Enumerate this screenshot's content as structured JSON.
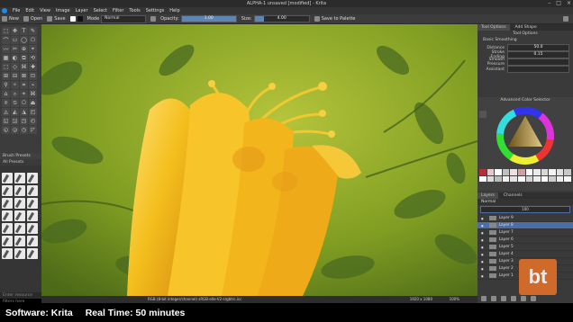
{
  "window": {
    "title": "ALPHA-1 unsaved [modified] - Krita"
  },
  "menu": [
    "File",
    "Edit",
    "View",
    "Image",
    "Layer",
    "Select",
    "Filter",
    "Tools",
    "Settings",
    "Help"
  ],
  "toolbar": {
    "new": "New",
    "open": "Open",
    "save": "Save",
    "blend_label": "Mode",
    "blend_value": "Normal",
    "opacity_label": "Opacity:",
    "opacity_value": "1.00",
    "opacity": 1.0,
    "size_label": "Size:",
    "size_value": "4.00",
    "palette_button": "Save to Palette"
  },
  "brush_presets": {
    "title": "Brush Presets",
    "filter": "All Presets",
    "search_placeholder": "Enter resource filters here"
  },
  "status": {
    "info": "RGB (8-bit integer/channel)  sRGB-elle-V2-srgbtrc.icc",
    "dims": "1920 x 1080",
    "zoom": "100%"
  },
  "docker": {
    "tabs": [
      "Tool Options",
      "Add Shape"
    ],
    "panel_title": "Tool Options",
    "smoothing_label": "Basic Smoothing",
    "rows": [
      {
        "label": "Distance",
        "value": "50.0"
      },
      {
        "label": "Stroke Ending",
        "value": "0.15"
      },
      {
        "label": "Smooth Pressure",
        "value": ""
      },
      {
        "label": "Assistant",
        "value": ""
      }
    ],
    "color_title": "Advanced Color Selector",
    "layer_tabs": [
      "Layers",
      "Channels"
    ],
    "blend": "Normal",
    "opacity": "100",
    "layers": [
      {
        "name": "Layer 9",
        "selected": false
      },
      {
        "name": "Layer 8",
        "selected": true
      },
      {
        "name": "Layer 7",
        "selected": false
      },
      {
        "name": "Layer 6",
        "selected": false
      },
      {
        "name": "Layer 5",
        "selected": false
      },
      {
        "name": "Layer 4",
        "selected": false
      },
      {
        "name": "Layer 3",
        "selected": false
      },
      {
        "name": "Layer 2",
        "selected": false
      },
      {
        "name": "Layer 1",
        "selected": false
      }
    ]
  },
  "caption": {
    "software": "Software: Krita",
    "time": "Real Time: 50 minutes"
  },
  "logo_text": "bt",
  "colors": {
    "accent": "#4b6fa5",
    "canvas_bg": "#86a524",
    "flower": "#f2c020",
    "logo": "#e0702a"
  }
}
